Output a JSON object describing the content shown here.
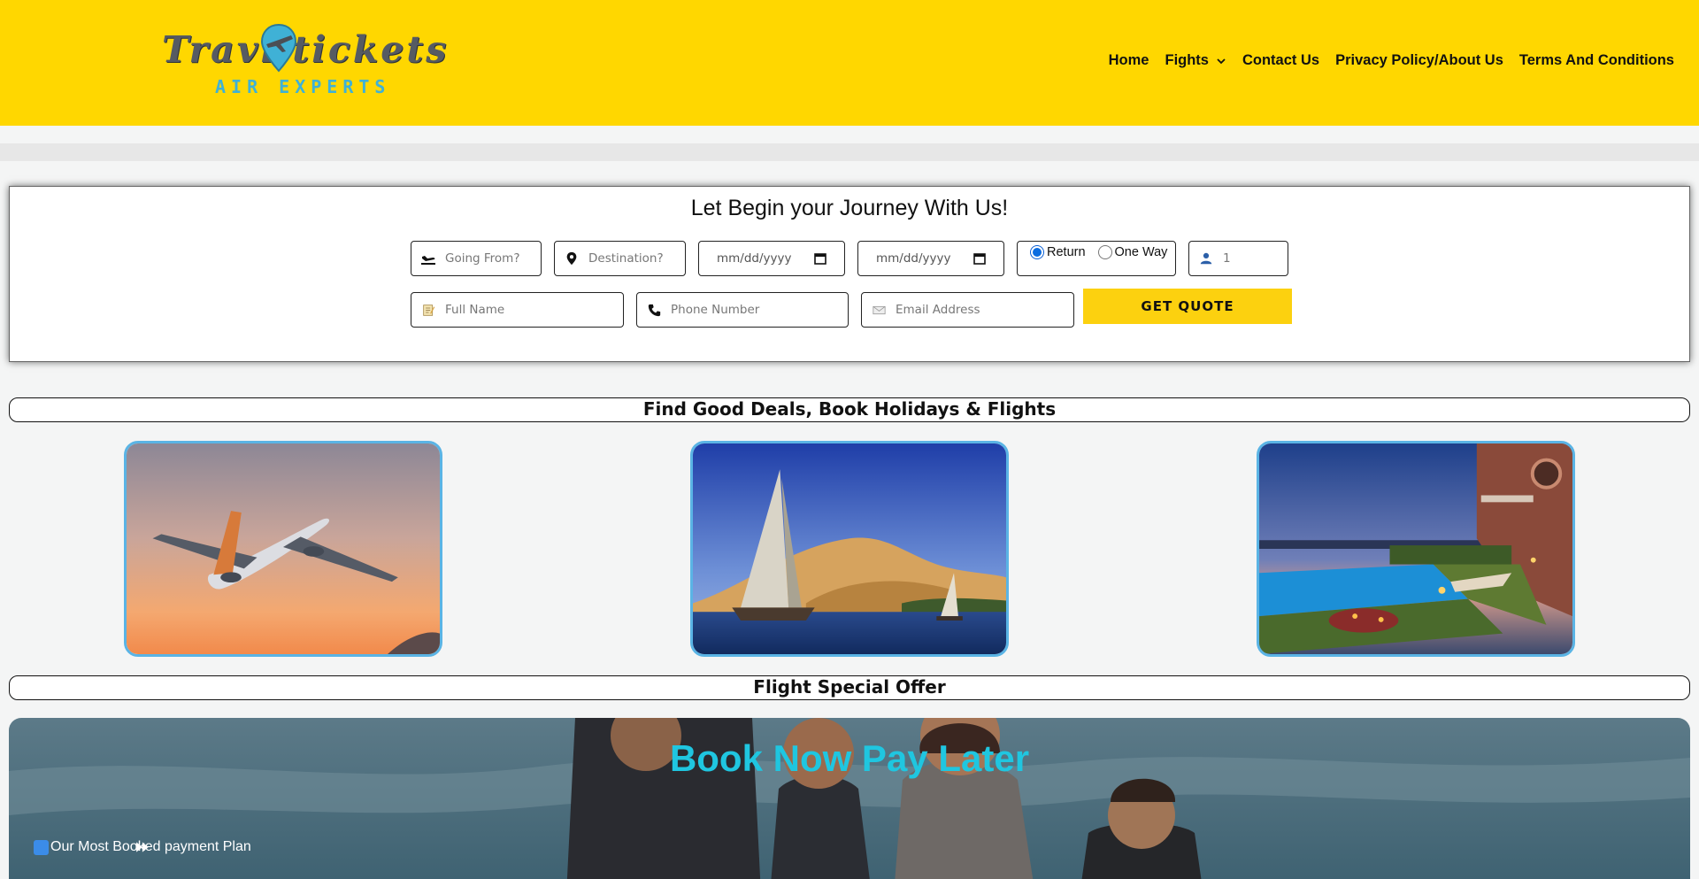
{
  "header": {
    "logo_top": "Travl tickets",
    "logo_bottom": "AIR EXPERTS",
    "nav": [
      {
        "label": "Home"
      },
      {
        "label": "Fights"
      },
      {
        "label": "Contact Us"
      },
      {
        "label": "Privacy Policy/About Us"
      },
      {
        "label": "Terms And Conditions"
      }
    ]
  },
  "booking": {
    "title": "Let Begin your Journey With Us!",
    "going_from_placeholder": "Going From?",
    "destination_placeholder": "Destination?",
    "depart_date_placeholder": "mm/dd/yyyy",
    "return_date_placeholder": "mm/dd/yyyy",
    "trip_type": {
      "return_label": "Return",
      "one_way_label": "One Way",
      "selected": "Return"
    },
    "passengers_value": "1",
    "full_name_placeholder": "Full Name",
    "phone_placeholder": "Phone Number",
    "email_placeholder": "Email Address",
    "submit_label": "GET QUOTE"
  },
  "deals": {
    "heading": "Find Good Deals, Book Holidays & Flights",
    "cards": [
      {
        "image": "airplane-sunset"
      },
      {
        "image": "sailboat-desert-river"
      },
      {
        "image": "villa-pool-dusk"
      }
    ]
  },
  "offer": {
    "heading": "Flight Special Offer",
    "banner_title": "Book Now Pay Later",
    "banner_subtitle": "Our Most Booked payment Plan"
  },
  "colors": {
    "header_bg": "#ffd700",
    "button_bg": "#fcd10f",
    "card_border": "#5ab4e5",
    "offer_title": "#1fc6e0"
  }
}
